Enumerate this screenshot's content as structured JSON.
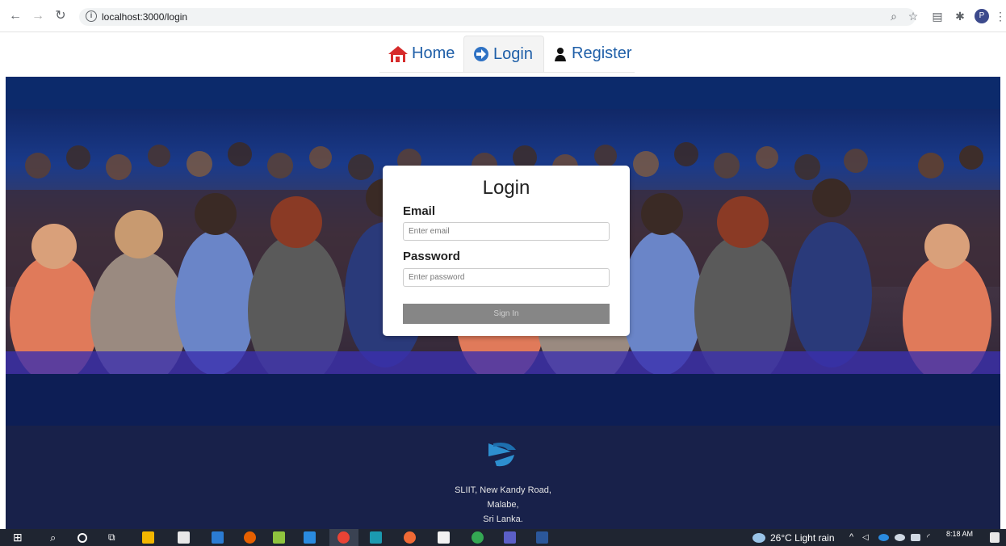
{
  "browser": {
    "url": "localhost:3000/login"
  },
  "nav": {
    "home": "Home",
    "login": "Login",
    "register": "Register"
  },
  "login_form": {
    "title": "Login",
    "email_label": "Email",
    "email_placeholder": "Enter email",
    "password_label": "Password",
    "password_placeholder": "Enter password",
    "submit_label": "Sign In"
  },
  "footer": {
    "address_line1": "SLIIT, New Kandy Road,",
    "address_line2": "Malabe,",
    "address_line3": "Sri Lanka."
  },
  "taskbar": {
    "weather": "26°C  Light rain",
    "time": "8:18 AM"
  },
  "colors": {
    "nav_link": "#1f5fa8",
    "footer_bg": "#18214a",
    "button_bg": "#868686"
  }
}
